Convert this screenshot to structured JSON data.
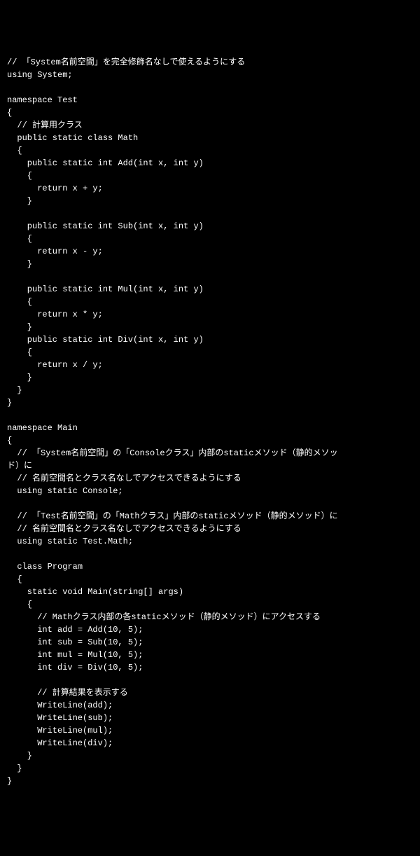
{
  "code": {
    "lines": [
      "// 「System名前空間」を完全修飾名なしで使えるようにする",
      "using System;",
      "",
      "namespace Test",
      "{",
      "  // 計算用クラス",
      "  public static class Math",
      "  {",
      "    public static int Add(int x, int y)",
      "    {",
      "      return x + y;",
      "    }",
      "",
      "    public static int Sub(int x, int y)",
      "    {",
      "      return x - y;",
      "    }",
      "",
      "    public static int Mul(int x, int y)",
      "    {",
      "      return x * y;",
      "    }",
      "    public static int Div(int x, int y)",
      "    {",
      "      return x / y;",
      "    }",
      "  }",
      "}",
      "",
      "namespace Main",
      "{",
      "  // 「System名前空間」の「Consoleクラス」内部のstaticメソッド（静的メソッ",
      "ド）に",
      "  // 名前空間名とクラス名なしでアクセスできるようにする",
      "  using static Console;",
      "",
      "  // 「Test名前空間」の「Mathクラス」内部のstaticメソッド（静的メソッド）に",
      "  // 名前空間名とクラス名なしでアクセスできるようにする",
      "  using static Test.Math;",
      "",
      "  class Program",
      "  {",
      "    static void Main(string[] args)",
      "    {",
      "      // Mathクラス内部の各staticメソッド（静的メソッド）にアクセスする",
      "      int add = Add(10, 5);",
      "      int sub = Sub(10, 5);",
      "      int mul = Mul(10, 5);",
      "      int div = Div(10, 5);",
      "",
      "      // 計算結果を表示する",
      "      WriteLine(add);",
      "      WriteLine(sub);",
      "      WriteLine(mul);",
      "      WriteLine(div);",
      "    }",
      "  }",
      "}"
    ]
  }
}
